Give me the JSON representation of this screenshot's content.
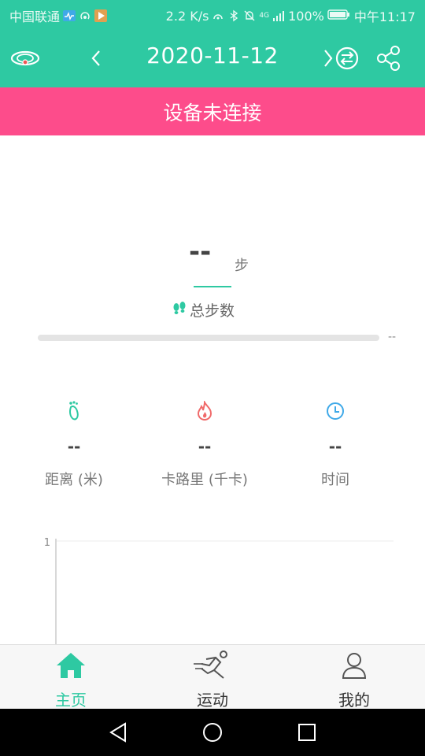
{
  "status_bar": {
    "carrier": "中国联通",
    "network_speed": "2.2 K/s",
    "network_type": "4G",
    "battery": "100%",
    "time": "中午11:17",
    "icons": [
      "heartbeat-icon",
      "hotspot-icon",
      "play-app-icon",
      "nfc-icon",
      "bluetooth-icon",
      "mute-icon",
      "signal-icon",
      "battery-icon"
    ]
  },
  "app_bar": {
    "date": "2020-11-12",
    "icons": [
      "band-device-icon",
      "back-arrow-icon",
      "switch-icon",
      "share-icon"
    ]
  },
  "banner": {
    "text": "设备未连接"
  },
  "steps": {
    "value": "--",
    "unit": "步",
    "label": "总步数",
    "icon": "footprints-icon",
    "goal_value": "--",
    "progress": 0
  },
  "stats": [
    {
      "icon": "foot-icon",
      "value": "--",
      "label": "距离 (米)",
      "color": "#2ec9a2"
    },
    {
      "icon": "flame-icon",
      "value": "--",
      "label": "卡路里 (千卡)",
      "color": "#f06a6a"
    },
    {
      "icon": "clock-icon",
      "value": "--",
      "label": "时间",
      "color": "#3fa9e8"
    }
  ],
  "chart": {
    "y_tick": "1"
  },
  "tabs": [
    {
      "label": "主页",
      "icon": "home-icon",
      "active": true
    },
    {
      "label": "运动",
      "icon": "running-icon",
      "active": false
    },
    {
      "label": "我的",
      "icon": "profile-icon",
      "active": false
    }
  ],
  "colors": {
    "primary": "#2ec9a2",
    "banner": "#fd4c8b",
    "text_dark": "#444444",
    "text_muted": "#777777"
  }
}
